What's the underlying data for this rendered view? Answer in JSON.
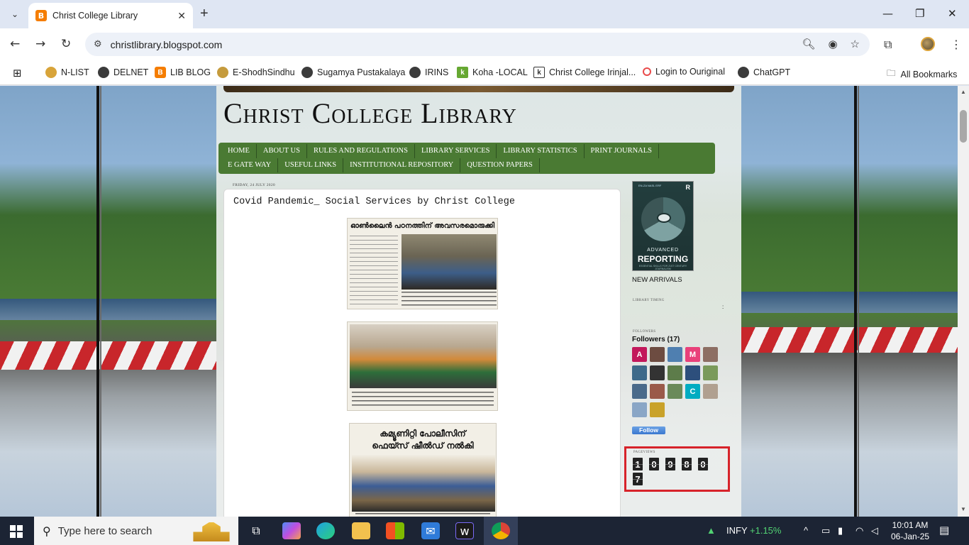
{
  "browser": {
    "tab_title": "Christ College Library",
    "tab_favicon": "B",
    "url": "christlibrary.blogspot.com",
    "bookmarks": [
      {
        "label": "N-LIST",
        "color": "#d8a43a"
      },
      {
        "label": "DELNET",
        "color": "#3b3b3b"
      },
      {
        "label": "LIB BLOG",
        "color": "#f57d00"
      },
      {
        "label": "E-ShodhSindhu",
        "color": "#c59b3d"
      },
      {
        "label": "Sugamya Pustakalaya",
        "color": "#3b3b3b"
      },
      {
        "label": "IRINS",
        "color": "#3b3b3b"
      },
      {
        "label": "Koha -LOCAL",
        "color": "#66a832"
      },
      {
        "label": "Christ College Irinjal...",
        "color": "#ffffff"
      },
      {
        "label": "Login to Ouriginal",
        "color": "#e94b4b"
      },
      {
        "label": "ChatGPT",
        "color": "#3b3b3b"
      }
    ],
    "all_bookmarks": "All Bookmarks"
  },
  "blog": {
    "title": "Christ College Library",
    "menu": [
      "HOME",
      "ABOUT US",
      "RULES AND REGULATIONS",
      "LIBRARY SERVICES",
      "LIBRARY STATISTICS",
      "PRINT JOURNALS",
      "E GATE WAY",
      "USEFUL LINKS",
      "INSTITUTIONAL REPOSITORY",
      "QUESTION PAPERS"
    ],
    "post": {
      "date": "Friday, 24 July 2020",
      "title": "Covid Pandemic_ Social Services by Christ College",
      "clip1_heading": "ഓൺലൈൻ പഠനത്തിന് അവസരമൊരുക്കി",
      "clip3_heading_1": "കമ്യൂണിറ്റി പോലീസിന്",
      "clip3_heading_2": "ഫെയ്സ് ഷീൽഡ് നൽകി"
    },
    "sidebar": {
      "book": {
        "tag": "EN-ZA NASL ERF",
        "publisher": "R",
        "line1": "ADVANCED",
        "line2": "REPORTING",
        "subtitle": "ESSENTIAL SKILLS FOR 21ST CENTURY JOURNALISM"
      },
      "new_arrivals": "NEW ARRIVALS",
      "library_timing": "LIBRARY TIMING",
      "library_timing_colon": ":",
      "followers_label": "FOLLOWERS",
      "followers_count": "Followers (17)",
      "follower_avatars": [
        {
          "letter": "A",
          "color": "#c2185b"
        },
        {
          "letter": "",
          "color": "#6d4c41"
        },
        {
          "letter": "",
          "color": "#4f7fb0"
        },
        {
          "letter": "M",
          "color": "#e9407a"
        },
        {
          "letter": "",
          "color": "#8d6e63"
        },
        {
          "letter": "",
          "color": "#3e6a8a"
        },
        {
          "letter": "",
          "color": "#333333"
        },
        {
          "letter": "",
          "color": "#5d7c4a"
        },
        {
          "letter": "",
          "color": "#2d4f7c"
        },
        {
          "letter": "",
          "color": "#7a9a5a"
        },
        {
          "letter": "",
          "color": "#4a6a8a"
        },
        {
          "letter": "",
          "color": "#9a5a4a"
        },
        {
          "letter": "",
          "color": "#6a8a5a"
        },
        {
          "letter": "C",
          "color": "#00acc1"
        },
        {
          "letter": "",
          "color": "#b0a090"
        },
        {
          "letter": "",
          "color": "#8aa6c6"
        },
        {
          "letter": "",
          "color": "#c9a22a"
        }
      ],
      "follow_button": "Follow",
      "pageviews_label": "PAGEVIEWS",
      "pageview_digits": [
        "1",
        "0",
        "9",
        "8",
        "0",
        "7"
      ]
    }
  },
  "taskbar": {
    "search_placeholder": "Type here to search",
    "stock_symbol": "INFY",
    "stock_change": "+1.15%",
    "time": "10:01 AM",
    "date": "06-Jan-25"
  }
}
